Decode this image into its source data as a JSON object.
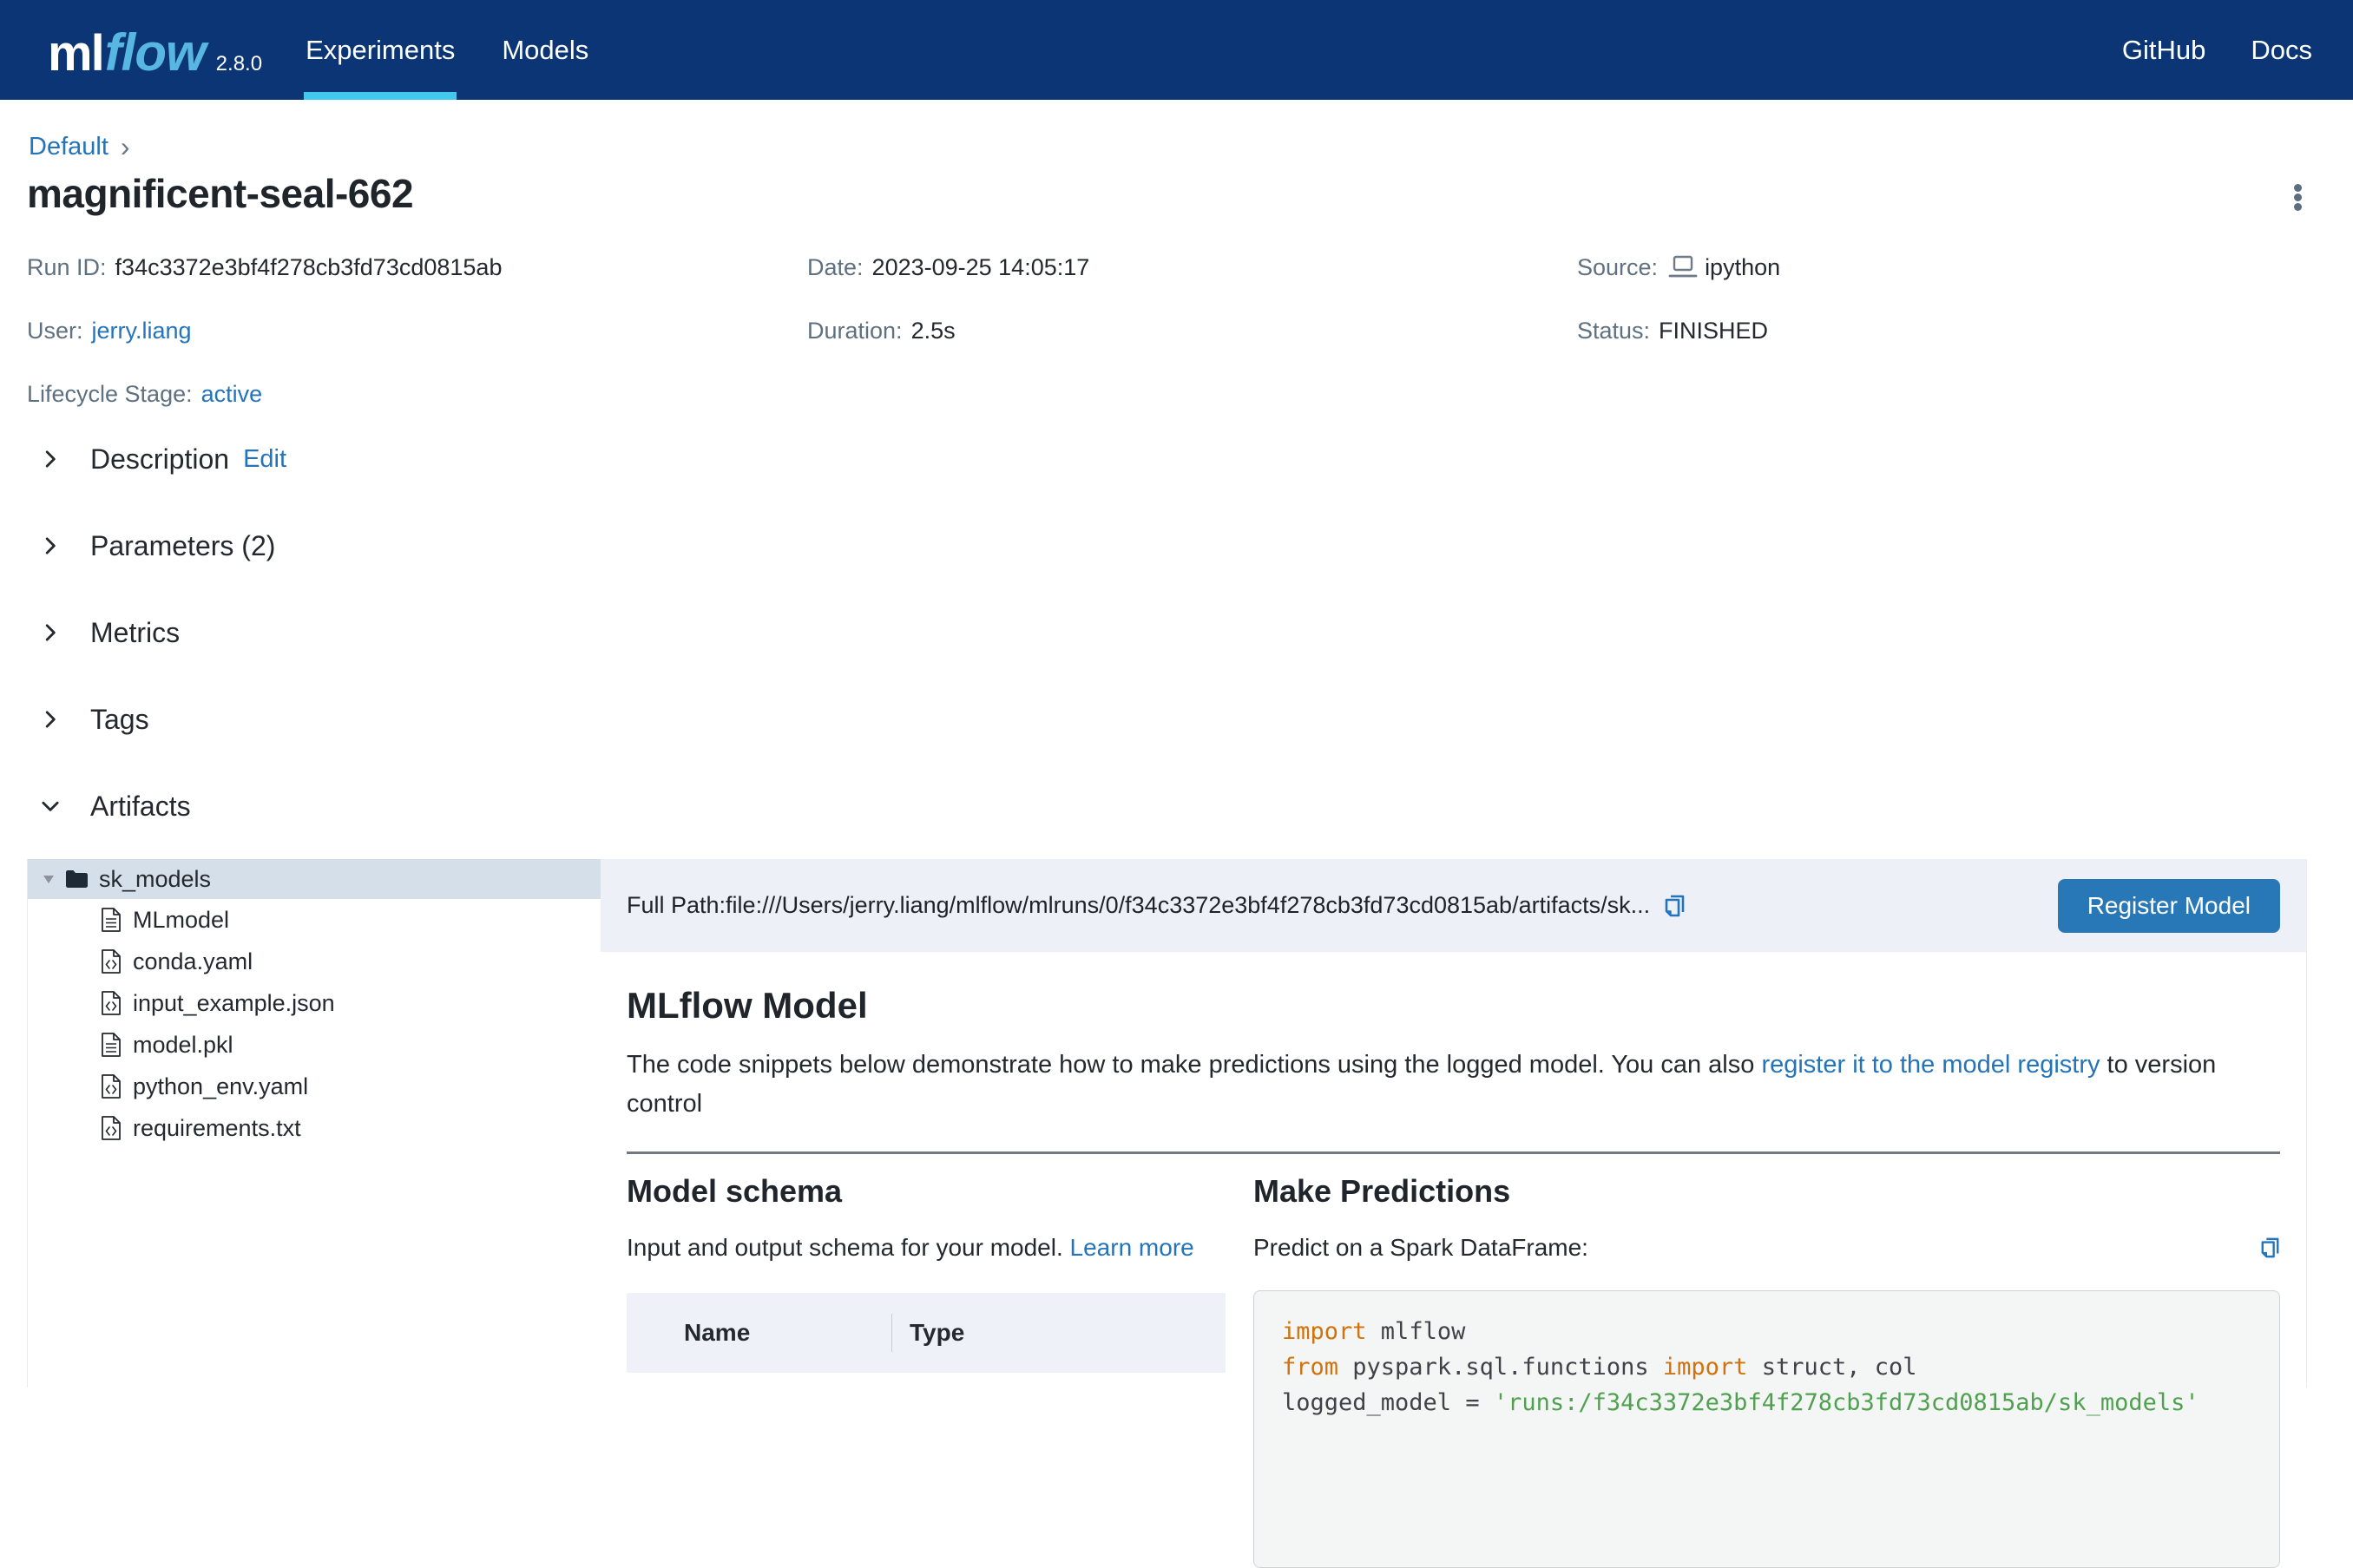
{
  "colors": {
    "navbar_bg": "#0b3574",
    "active_tab_accent": "#43c9ed",
    "link_blue": "#2374bb",
    "button_blue": "#2878b8",
    "selected_row_bg": "#d5dfe9",
    "keyword_orange": "#d1720d",
    "string_green": "#50a14f"
  },
  "navbar": {
    "logo": {
      "ml": "ml",
      "flow": "flow",
      "version": "2.8.0"
    },
    "tabs": [
      {
        "label": "Experiments",
        "active": true
      },
      {
        "label": "Models",
        "active": false
      }
    ],
    "links": [
      {
        "label": "GitHub"
      },
      {
        "label": "Docs"
      }
    ]
  },
  "breadcrumb": {
    "experiment": "Default",
    "separator": "›"
  },
  "run": {
    "title": "magnificent-seal-662",
    "meta": {
      "run_id_label": "Run ID:",
      "run_id": "f34c3372e3bf4f278cb3fd73cd0815ab",
      "date_label": "Date:",
      "date": "2023-09-25 14:05:17",
      "source_label": "Source:",
      "source": "ipython",
      "user_label": "User:",
      "user": "jerry.liang",
      "duration_label": "Duration:",
      "duration": "2.5s",
      "status_label": "Status:",
      "status": "FINISHED",
      "lifecycle_label": "Lifecycle Stage:",
      "lifecycle": "active"
    }
  },
  "sections": [
    {
      "label": "Description",
      "edit_label": "Edit"
    },
    {
      "label": "Parameters (2)"
    },
    {
      "label": "Metrics"
    },
    {
      "label": "Tags"
    },
    {
      "label": "Artifacts"
    }
  ],
  "artifacts": {
    "tree": {
      "folder": "sk_models",
      "files": [
        {
          "name": "MLmodel",
          "icon": "file-text"
        },
        {
          "name": "conda.yaml",
          "icon": "file-code"
        },
        {
          "name": "input_example.json",
          "icon": "file-code"
        },
        {
          "name": "model.pkl",
          "icon": "file-text"
        },
        {
          "name": "python_env.yaml",
          "icon": "file-code"
        },
        {
          "name": "requirements.txt",
          "icon": "file-code"
        }
      ]
    },
    "pathbar": {
      "full_path": "Full Path:file:///Users/jerry.liang/mlflow/mlruns/0/f34c3372e3bf4f278cb3fd73cd0815ab/artifacts/sk...",
      "register_button": "Register Model"
    },
    "model": {
      "title": "MLflow Model",
      "desc_before": "The code snippets below demonstrate how to make predictions using the logged model. You can also ",
      "desc_link": "register it to the model registry",
      "desc_after": " to version control"
    },
    "schema": {
      "title": "Model schema",
      "subtitle": "Input and output schema for your model. ",
      "learn_more": "Learn more",
      "col_name": "Name",
      "col_type": "Type"
    },
    "predictions": {
      "title": "Make Predictions",
      "subtitle": "Predict on a Spark DataFrame:",
      "code": {
        "l1_kw": "import",
        "l1_rest": " mlflow",
        "l2_kw1": "from",
        "l2_mid": " pyspark.sql.functions ",
        "l2_kw2": "import",
        "l2_rest": " struct, col",
        "l3_plain": "logged_model = ",
        "l3_str": "'runs:/f34c3372e3bf4f278cb3fd73cd0815ab/sk_models'"
      }
    }
  }
}
